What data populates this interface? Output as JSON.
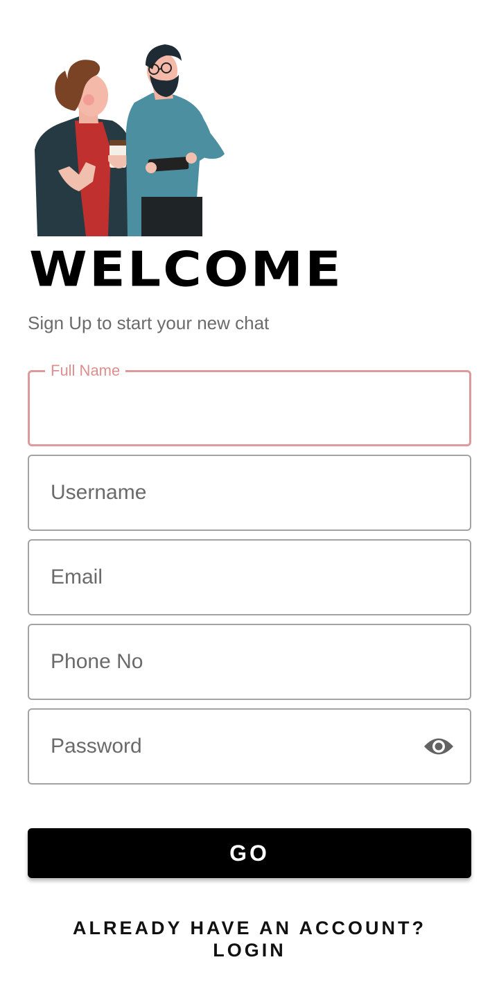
{
  "header": {
    "title": "WELCOME",
    "subtitle": "Sign Up to start your new chat"
  },
  "form": {
    "full_name": {
      "label": "Full Name",
      "value": ""
    },
    "username": {
      "placeholder": "Username"
    },
    "email": {
      "placeholder": "Email"
    },
    "phone": {
      "placeholder": "Phone No"
    },
    "password": {
      "placeholder": "Password",
      "toggle_icon": "eye-icon"
    }
  },
  "actions": {
    "go_label": "GO",
    "login_line1": "ALREADY HAVE AN ACCOUNT?",
    "login_line2": "LOGIN"
  },
  "colors": {
    "focus_border": "#dc9a9a",
    "focus_label": "#dc8f8f",
    "button_bg": "#000000"
  }
}
